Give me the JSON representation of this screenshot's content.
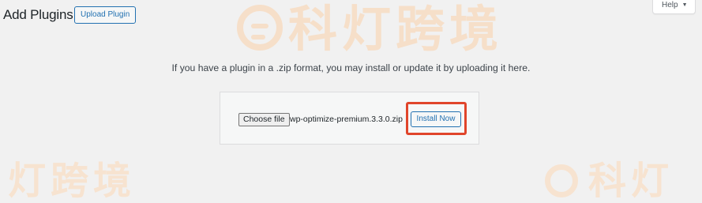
{
  "header": {
    "title": "Add Plugins",
    "upload_plugin_label": "Upload Plugin",
    "help_label": "Help",
    "help_arrow": "▼"
  },
  "upload": {
    "description": "If you have a plugin in a .zip format, you may install or update it by uploading it here.",
    "choose_file_label": "Choose file",
    "file_name": "wp-optimize-premium.3.3.0.zip",
    "install_now_label": "Install Now"
  },
  "watermark": {
    "text": "科灯跨境",
    "text_bottom_left": "灯跨境",
    "text_bottom_right": "科灯"
  },
  "colors": {
    "accent": "#2271b1",
    "highlight": "#e0452b",
    "background": "#f1f1f1",
    "watermark": "#f6dfc9"
  }
}
